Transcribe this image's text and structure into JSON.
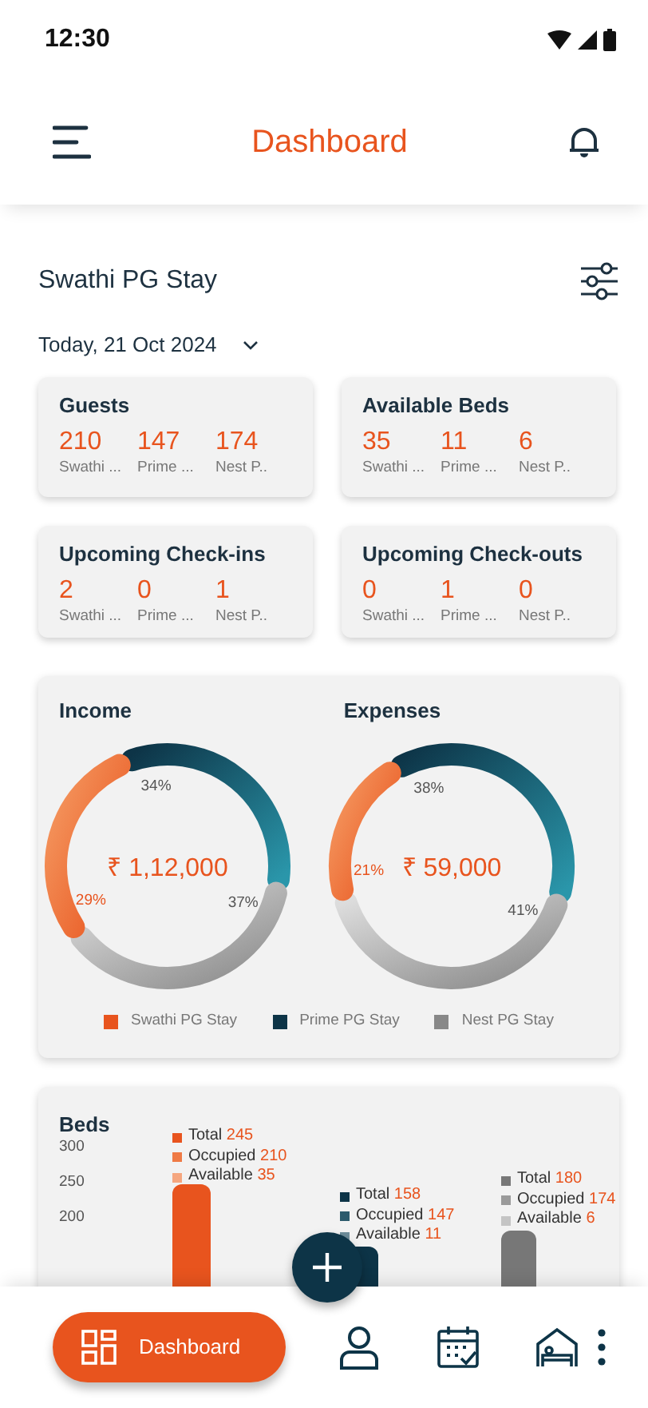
{
  "status_bar": {
    "time": "12:30"
  },
  "header": {
    "title": "Dashboard"
  },
  "property": {
    "name": "Swathi PG Stay"
  },
  "date_filter": {
    "label": "Today, 21 Oct 2024"
  },
  "stat_cards": [
    {
      "title": "Guests",
      "values": [
        {
          "value": "210",
          "label": "Swathi ..."
        },
        {
          "value": "147",
          "label": "Prime ..."
        },
        {
          "value": "174",
          "label": "Nest P.."
        }
      ]
    },
    {
      "title": "Available Beds",
      "values": [
        {
          "value": "35",
          "label": "Swathi ..."
        },
        {
          "value": "11",
          "label": "Prime ..."
        },
        {
          "value": "6",
          "label": "Nest P.."
        }
      ]
    },
    {
      "title": "Upcoming Check-ins",
      "values": [
        {
          "value": "2",
          "label": "Swathi ..."
        },
        {
          "value": "0",
          "label": "Prime ..."
        },
        {
          "value": "1",
          "label": "Nest P.."
        }
      ]
    },
    {
      "title": "Upcoming Check-outs",
      "values": [
        {
          "value": "0",
          "label": "Swathi ..."
        },
        {
          "value": "1",
          "label": "Prime ..."
        },
        {
          "value": "0",
          "label": "Nest P.."
        }
      ]
    }
  ],
  "donuts": [
    {
      "title": "Income",
      "total": "₹ 1,12,000",
      "segments": [
        {
          "share": "34%",
          "kind": "prime"
        },
        {
          "share": "37%",
          "kind": "nest"
        },
        {
          "share": "29%",
          "kind": "swathi"
        }
      ]
    },
    {
      "title": "Expenses",
      "total": "₹ 59,000",
      "segments": [
        {
          "share": "38%",
          "kind": "prime"
        },
        {
          "share": "41%",
          "kind": "nest"
        },
        {
          "share": "21%",
          "kind": "swathi"
        }
      ]
    }
  ],
  "legend": [
    {
      "label": "Swathi PG Stay",
      "color": "#e8541e"
    },
    {
      "label": "Prime PG Stay",
      "color": "#0d3447"
    },
    {
      "label": "Nest PG Stay",
      "color": "#888888"
    }
  ],
  "beds": {
    "title": "Beds",
    "yticks": [
      "300",
      "250",
      "200"
    ],
    "groups": [
      {
        "items": [
          {
            "label": "Total",
            "value": "245",
            "color": "#e8541e"
          },
          {
            "label": "Occupied",
            "value": "210",
            "color": "#ef7a45"
          },
          {
            "label": "Available",
            "value": "35",
            "color": "#f5a67f"
          }
        ]
      },
      {
        "items": [
          {
            "label": "Total",
            "value": "158",
            "color": "#0d3447"
          },
          {
            "label": "Occupied",
            "value": "147",
            "color": "#2c5a6c"
          },
          {
            "label": "Available",
            "value": "11",
            "color": "#6d8c99"
          }
        ]
      },
      {
        "items": [
          {
            "label": "Total",
            "value": "180",
            "color": "#777777"
          },
          {
            "label": "Occupied",
            "value": "174",
            "color": "#9a9a9a"
          },
          {
            "label": "Available",
            "value": "6",
            "color": "#c4c4c4"
          }
        ]
      }
    ]
  },
  "bottom_nav": [
    {
      "kind": "dashboard",
      "label": "Dashboard",
      "selected": true
    },
    {
      "kind": "guests",
      "selected": false
    },
    {
      "kind": "calendar",
      "selected": false
    },
    {
      "kind": "rooms",
      "selected": false
    },
    {
      "kind": "more",
      "selected": false
    }
  ]
}
